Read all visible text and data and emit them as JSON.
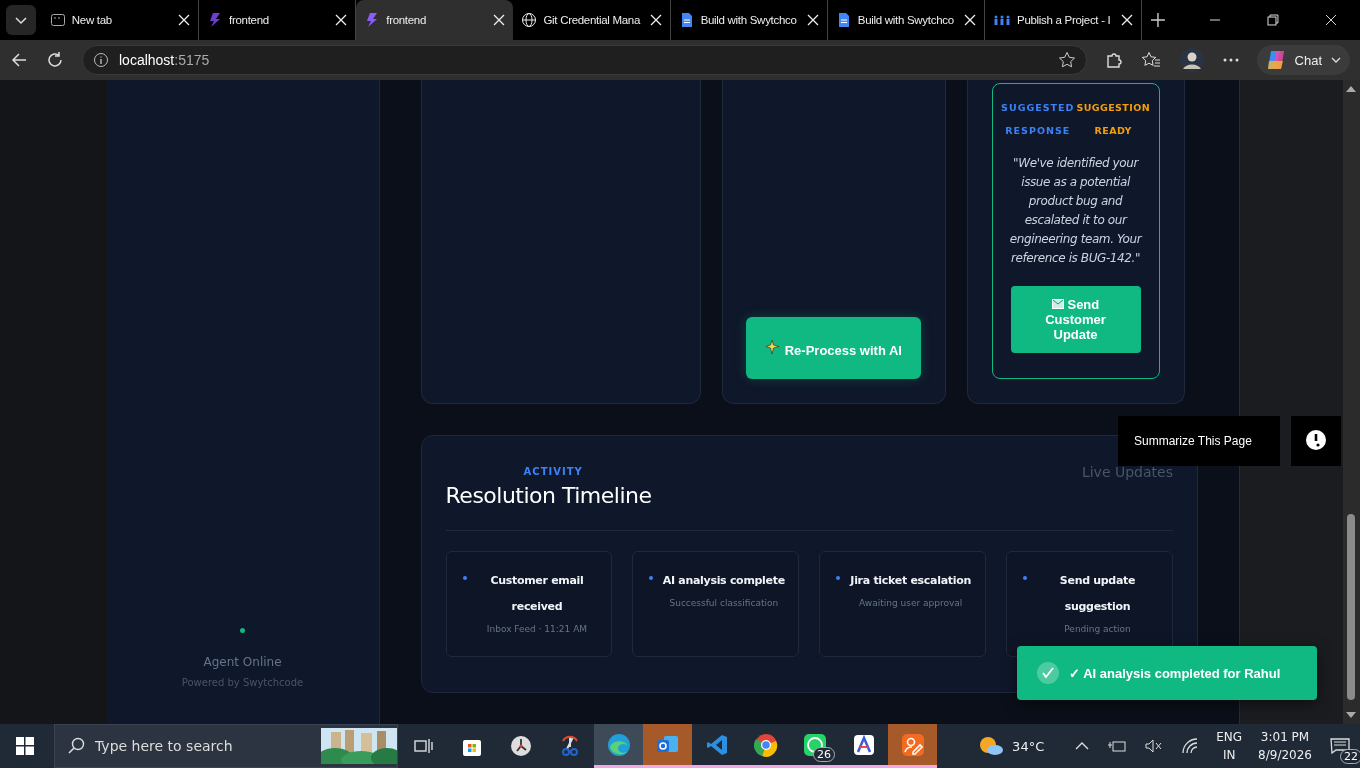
{
  "browser": {
    "tabs": [
      {
        "title": "New tab",
        "kind": "newtab",
        "selected": false
      },
      {
        "title": "frontend",
        "kind": "app",
        "selected": false
      },
      {
        "title": "frontend",
        "kind": "app",
        "selected": true
      },
      {
        "title": "Git Credential Mana",
        "kind": "web",
        "selected": false
      },
      {
        "title": "Build with Swytchco",
        "kind": "doc",
        "selected": false
      },
      {
        "title": "Build with Swytchco",
        "kind": "doc",
        "selected": false
      },
      {
        "title": "Publish a Project - I",
        "kind": "team",
        "selected": false
      }
    ],
    "address": {
      "host": "localhost",
      "port": ":5175"
    },
    "chat_button": "Chat"
  },
  "sidebar": {
    "status": "Agent Online",
    "powered_by": "Powered by Swytchcode"
  },
  "reprocess_button": "Re-Process with AI",
  "suggestion": {
    "label_left": "SUGGESTED",
    "label_right": "SUGGESTION",
    "label_left_2": "RESPONSE",
    "label_right_2": "READY",
    "quote": "\"We've identified your issue as a potential product bug and escalated it to our engineering team. Your reference is BUG-142.\"",
    "button": "Send Customer Update"
  },
  "timeline": {
    "eyebrow": "ACTIVITY",
    "title": "Resolution Timeline",
    "live": "Live Updates",
    "events": [
      {
        "title": "Customer email received",
        "detail": "Inbox Feed · 11:21 AM"
      },
      {
        "title": "AI analysis complete",
        "detail": "Successful classification"
      },
      {
        "title": "Jira ticket escalation",
        "detail": "Awaiting user approval"
      },
      {
        "title": "Send update suggestion",
        "detail": "Pending action"
      }
    ]
  },
  "summarize": {
    "label": "Summarize This Page"
  },
  "toast": {
    "message": "✓ AI analysis completed for Rahul"
  },
  "taskbar": {
    "search_placeholder": "Type here to search",
    "apps": [
      {
        "kind": "taskview",
        "selected": false,
        "running": false,
        "flashing": false
      },
      {
        "kind": "store",
        "selected": false,
        "running": false,
        "flashing": false
      },
      {
        "kind": "clock",
        "selected": false,
        "running": false,
        "flashing": false
      },
      {
        "kind": "snip",
        "selected": false,
        "running": false,
        "flashing": false
      },
      {
        "kind": "edge",
        "selected": true,
        "running": true,
        "flashing": false
      },
      {
        "kind": "outlook",
        "selected": false,
        "running": true,
        "flashing": true
      },
      {
        "kind": "vscode",
        "selected": false,
        "running": true,
        "flashing": false
      },
      {
        "kind": "chrome",
        "selected": false,
        "running": true,
        "flashing": false
      },
      {
        "kind": "whatsapp",
        "selected": false,
        "running": true,
        "flashing": false,
        "badge": "26"
      },
      {
        "kind": "arc",
        "selected": false,
        "running": true,
        "flashing": false
      },
      {
        "kind": "draw",
        "selected": false,
        "running": true,
        "flashing": true
      }
    ],
    "weather": "34°C",
    "lang": "ENG",
    "region": "IN",
    "time": "3:01 PM",
    "date": "8/9/2026",
    "notifications": "22"
  }
}
